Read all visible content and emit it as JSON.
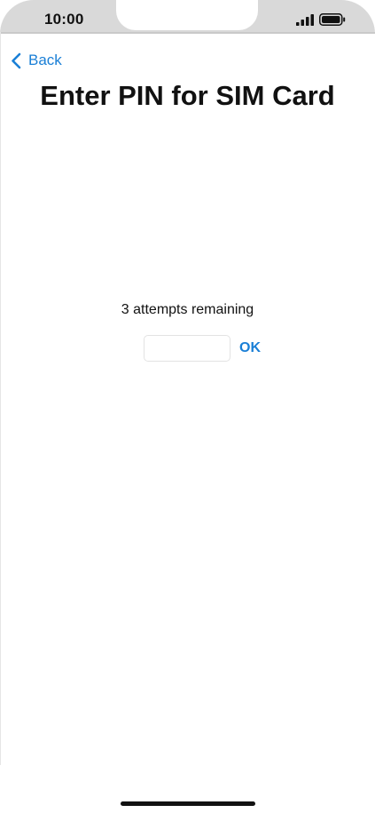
{
  "status_bar": {
    "time": "10:00",
    "signal_icon": "cellular-signal-icon",
    "battery_icon": "battery-icon"
  },
  "nav": {
    "back_label": "Back",
    "back_icon": "chevron-left-icon"
  },
  "title": "Enter PIN for SIM Card",
  "pin": {
    "attempts_text": "3 attempts remaining",
    "input_value": "",
    "ok_label": "OK"
  },
  "colors": {
    "accent": "#1a7fd6",
    "text": "#111111",
    "frame": "#d9d9d9"
  }
}
